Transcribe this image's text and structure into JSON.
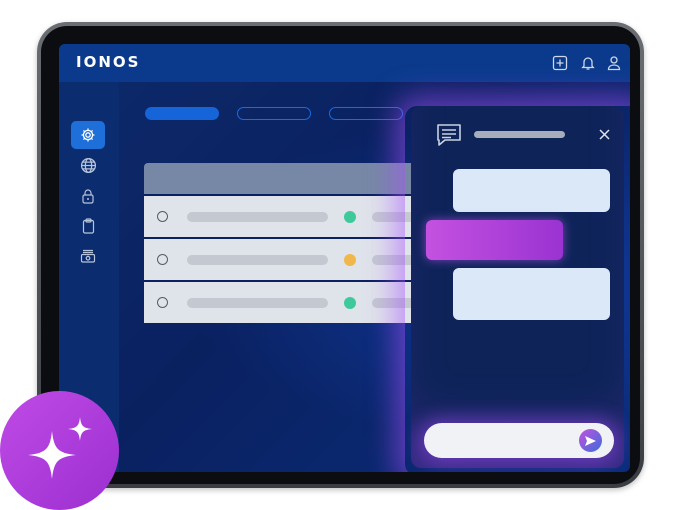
{
  "app": {
    "brand": "IONOS"
  },
  "topbar": {
    "icons": [
      "add-square-icon",
      "bell-icon",
      "user-icon"
    ]
  },
  "sidebar": {
    "items": [
      {
        "icon": "gear-icon",
        "active": true
      },
      {
        "icon": "globe-icon",
        "active": false
      },
      {
        "icon": "lock-icon",
        "active": false
      },
      {
        "icon": "clipboard-icon",
        "active": false
      },
      {
        "icon": "server-icon",
        "active": false
      }
    ]
  },
  "tabs": [
    {
      "style": "filled"
    },
    {
      "style": "outline"
    },
    {
      "style": "outline"
    }
  ],
  "table": {
    "rows": [
      {
        "status_color": "#3ec99a"
      },
      {
        "status_color": "#f0b84b"
      },
      {
        "status_color": "#3ec99a"
      }
    ]
  },
  "chat": {
    "close_icon": "close-icon",
    "header_icon": "chat-icon",
    "send_icon": "send-icon"
  },
  "badge": {
    "icon": "sparkles-icon"
  },
  "colors": {
    "accent": "#1565d8",
    "ai_purple": "#b040e0",
    "topbar": "#0b3a8c"
  }
}
